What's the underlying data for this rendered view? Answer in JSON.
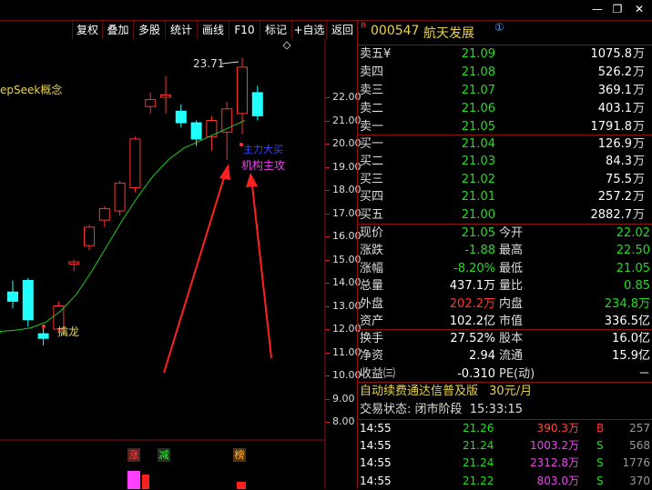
{
  "window": {
    "buttons": [
      "—",
      "❐",
      "✕"
    ]
  },
  "toolbar": {
    "items": [
      "复权",
      "叠加",
      "多股",
      "统计",
      "画线",
      "F10",
      "标记",
      "+自选",
      "返回"
    ]
  },
  "stock": {
    "badge": "R",
    "code": "000547",
    "name": "航天发展",
    "info_mark": "①"
  },
  "chart": {
    "concept_label": "epSeek概念",
    "high_label": "23.71",
    "price_axis": [
      "22.00",
      "21.00",
      "20.00",
      "19.00",
      "18.00",
      "17.00",
      "16.00",
      "15.00",
      "14.00",
      "13.00",
      "12.00",
      "11.00",
      "10.00",
      "9.00",
      "8.00"
    ],
    "annotation_1": "主力大买",
    "annotation_2": "机构主攻",
    "dragon_label": "擒龙",
    "event_labels": [
      "涨",
      "减",
      "榜"
    ]
  },
  "chart_data": {
    "type": "candlestick",
    "candles": [
      {
        "o": 13.6,
        "h": 14.1,
        "l": 12.9,
        "c": 13.2
      },
      {
        "o": 14.1,
        "h": 14.2,
        "l": 12.1,
        "c": 12.4
      },
      {
        "o": 11.8,
        "h": 12.2,
        "l": 11.3,
        "c": 11.6
      },
      {
        "o": 12.0,
        "h": 13.2,
        "l": 11.9,
        "c": 13.0
      },
      {
        "o": 14.8,
        "h": 15.0,
        "l": 14.5,
        "c": 14.9
      },
      {
        "o": 15.6,
        "h": 16.5,
        "l": 15.4,
        "c": 16.4
      },
      {
        "o": 16.7,
        "h": 17.3,
        "l": 16.4,
        "c": 17.2
      },
      {
        "o": 17.1,
        "h": 18.4,
        "l": 16.9,
        "c": 18.3
      },
      {
        "o": 18.1,
        "h": 20.3,
        "l": 17.9,
        "c": 20.2
      },
      {
        "o": 21.6,
        "h": 22.2,
        "l": 21.3,
        "c": 21.9
      },
      {
        "o": 22.0,
        "h": 22.9,
        "l": 21.3,
        "c": 22.1
      },
      {
        "o": 21.4,
        "h": 21.7,
        "l": 20.7,
        "c": 20.9
      },
      {
        "o": 20.9,
        "h": 21.0,
        "l": 19.9,
        "c": 20.2
      },
      {
        "o": 20.3,
        "h": 21.2,
        "l": 19.7,
        "c": 21.0
      },
      {
        "o": 20.5,
        "h": 21.8,
        "l": 19.3,
        "c": 21.5
      },
      {
        "o": 21.3,
        "h": 23.71,
        "l": 20.4,
        "c": 23.3
      },
      {
        "o": 22.2,
        "h": 22.5,
        "l": 21.0,
        "c": 21.2
      }
    ],
    "ma": [
      11.9,
      11.95,
      12.05,
      12.3,
      12.8,
      13.5,
      14.5,
      15.6,
      16.7,
      17.7,
      18.6,
      19.3,
      19.8,
      20.1,
      20.4,
      20.7,
      21.0
    ],
    "ylim": [
      8.0,
      22.0
    ]
  },
  "quote": {
    "ask": [
      {
        "label": "卖五",
        "mark": "¥",
        "price": "21.09",
        "vol": "1075.8",
        "unit": "万"
      },
      {
        "label": "卖四",
        "mark": "",
        "price": "21.08",
        "vol": "526.2",
        "unit": "万"
      },
      {
        "label": "卖三",
        "mark": "",
        "price": "21.07",
        "vol": "369.1",
        "unit": "万"
      },
      {
        "label": "卖二",
        "mark": "",
        "price": "21.06",
        "vol": "403.1",
        "unit": "万"
      },
      {
        "label": "卖一",
        "mark": "",
        "price": "21.05",
        "vol": "1791.8",
        "unit": "万"
      }
    ],
    "bid": [
      {
        "label": "买一",
        "price": "21.04",
        "vol": "126.9",
        "unit": "万"
      },
      {
        "label": "买二",
        "price": "21.03",
        "vol": "84.3",
        "unit": "万"
      },
      {
        "label": "买三",
        "price": "21.02",
        "vol": "75.5",
        "unit": "万"
      },
      {
        "label": "买四",
        "price": "21.01",
        "vol": "257.2",
        "unit": "万"
      },
      {
        "label": "买五",
        "price": "21.00",
        "vol": "2882.7",
        "unit": "万"
      }
    ],
    "stats_a": [
      {
        "l1": "现价",
        "v1": "21.05",
        "c1": "green",
        "l2": "今开",
        "v2": "22.02",
        "c2": "green"
      },
      {
        "l1": "涨跌",
        "v1": "-1.88",
        "c1": "green",
        "l2": "最高",
        "v2": "22.50",
        "c2": "green"
      },
      {
        "l1": "涨幅",
        "v1": "-8.20%",
        "c1": "green",
        "l2": "最低",
        "v2": "21.05",
        "c2": "green"
      },
      {
        "l1": "总量",
        "v1": "437.1万",
        "c1": "white",
        "l2": "量比",
        "v2": "0.85",
        "c2": "green"
      },
      {
        "l1": "外盘",
        "v1": "202.2万",
        "c1": "red",
        "l2": "内盘",
        "v2": "234.8万",
        "c2": "green"
      },
      {
        "l1": "资产",
        "v1": "102.2亿",
        "c1": "white",
        "l2": "市值",
        "v2": "336.5亿",
        "c2": "white"
      }
    ],
    "stats_b": [
      {
        "l1": "换手",
        "v1": "27.52%",
        "l2": "股本",
        "v2": "16.0亿"
      },
      {
        "l1": "净资",
        "v1": "2.94",
        "l2": "流通",
        "v2": "15.9亿"
      },
      {
        "l1": "收益㈢",
        "v1": "-0.310",
        "l2": "PE(动)",
        "v2": "－"
      }
    ]
  },
  "promo": {
    "text": "自动续费通达信普及版",
    "price": "30元/月"
  },
  "status": {
    "label": "交易状态:",
    "value": "闭市阶段",
    "time": "15:33:15"
  },
  "trades": [
    {
      "time": "14:55",
      "price": "21.26",
      "amount": "390.3万",
      "side": "B",
      "count": "257"
    },
    {
      "time": "14:55",
      "price": "21.24",
      "amount": "1003.2万",
      "side": "S",
      "count": "568"
    },
    {
      "time": "14:55",
      "price": "21.24",
      "amount": "2312.8万",
      "side": "S",
      "count": "1776"
    },
    {
      "time": "14:55",
      "price": "21.22",
      "amount": "803.0万",
      "side": "S",
      "count": "370"
    }
  ],
  "colors": {
    "up": "#ff3333",
    "down": "#22ffff",
    "ma": "#22cc22",
    "text_yellow": "#e8d44d",
    "border": "#8b1010"
  }
}
